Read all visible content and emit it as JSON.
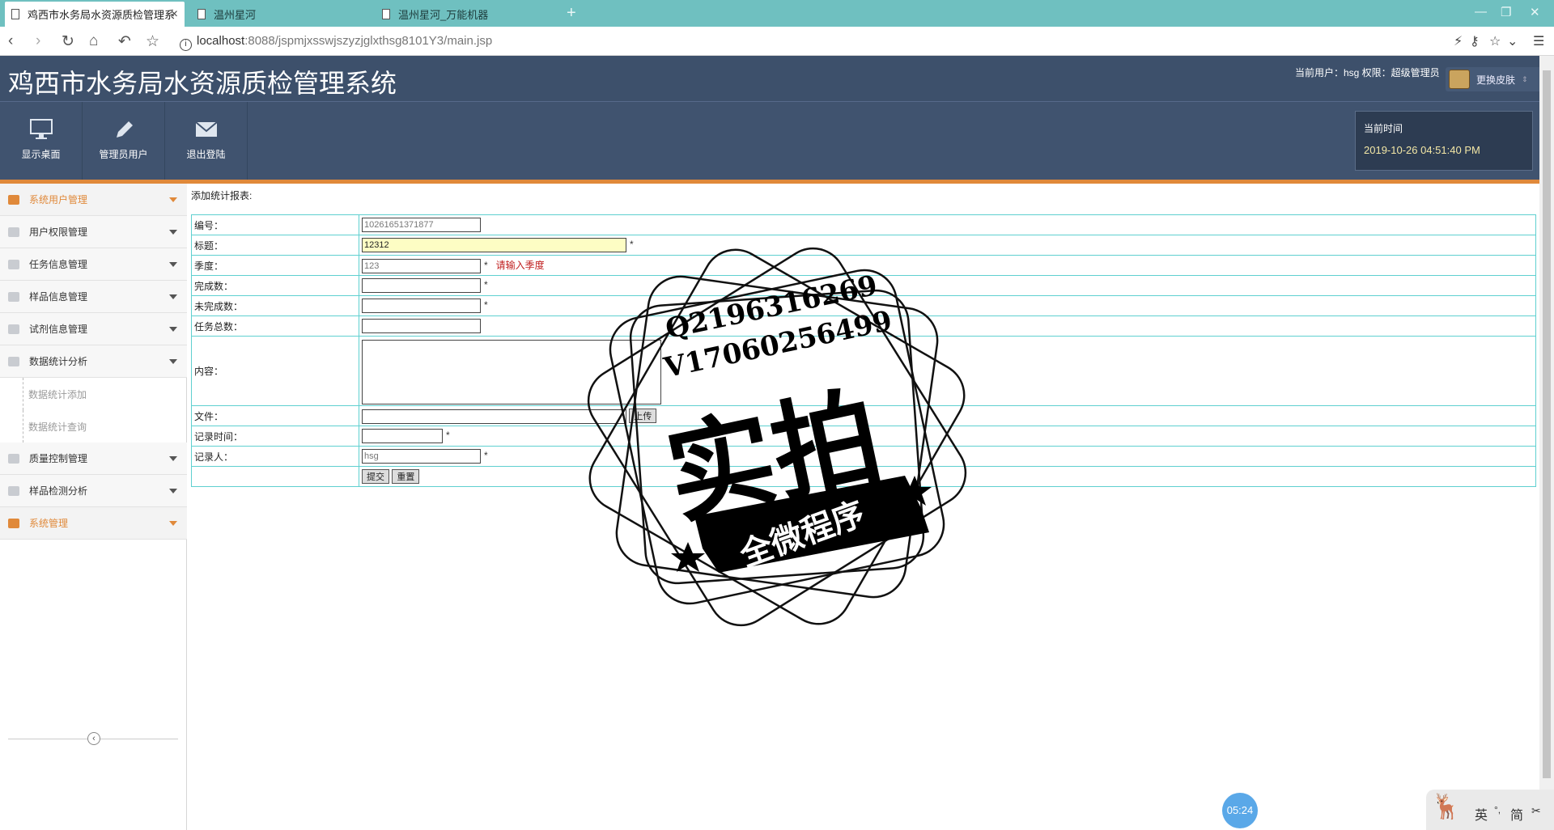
{
  "browser": {
    "tabs": [
      {
        "title": "鸡西市水务局水资源质检管理系"
      },
      {
        "title": "温州星河"
      },
      {
        "title": "温州星河_万能机器"
      }
    ],
    "new_tab": "+",
    "url_host": "localhost",
    "url_rest": ":8088/jspmjxsswjszyzjglxthsg8101Y3/main.jsp"
  },
  "header": {
    "title": "鸡西市水务局水资源质检管理系统",
    "user_info": "当前用户：hsg 权限：超级管理员",
    "skin_label": "更换皮肤"
  },
  "toolbar": {
    "desktop": "显示桌面",
    "admin_users": "管理员用户",
    "logout": "退出登陆",
    "time_label": "当前时间",
    "time_value": "2019-10-26 04:51:40 PM"
  },
  "sidebar": {
    "items": [
      {
        "label": "系统用户管理"
      },
      {
        "label": "用户权限管理"
      },
      {
        "label": "任务信息管理"
      },
      {
        "label": "样品信息管理"
      },
      {
        "label": "试剂信息管理"
      },
      {
        "label": "数据统计分析"
      },
      {
        "label": "质量控制管理"
      },
      {
        "label": "样品检测分析"
      },
      {
        "label": "系统管理"
      }
    ],
    "subitems": [
      {
        "label": "数据统计添加"
      },
      {
        "label": "数据统计查询"
      }
    ]
  },
  "form": {
    "heading": "添加统计报表:",
    "fields": {
      "bianhao": {
        "label": "编号：",
        "value": "10261651371877"
      },
      "biaoti": {
        "label": "标题：",
        "value": "12312"
      },
      "jidu": {
        "label": "季度：",
        "value": "123",
        "error": "请输入季度"
      },
      "wanchengshu": {
        "label": "完成数："
      },
      "weiwanchengshu": {
        "label": "未完成数："
      },
      "renwuzongshu": {
        "label": "任务总数："
      },
      "neirong": {
        "label": "内容："
      },
      "wenjian": {
        "label": "文件：",
        "upload": "上传"
      },
      "jilushijian": {
        "label": "记录时间："
      },
      "jiluren": {
        "label": "记录人：",
        "value": "hsg"
      }
    },
    "required_mark": "*",
    "submit": "提交",
    "reset": "重置"
  },
  "watermark": {
    "line1": "Q2196316269",
    "line2": "V17060256499",
    "big": "实拍",
    "ribbon": "全微程序"
  },
  "taskbar": {
    "clock": "05:24",
    "ime_lang": "英",
    "ime_mode": "简"
  }
}
